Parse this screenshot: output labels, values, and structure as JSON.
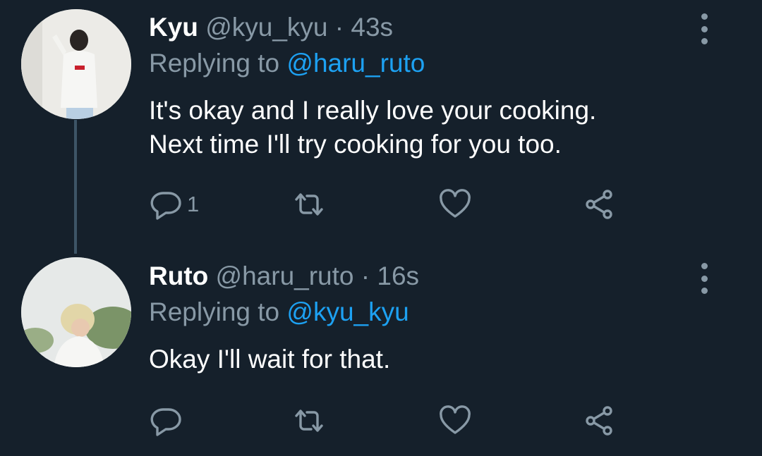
{
  "tweets": [
    {
      "name": "Kyu",
      "handle": "@kyu_kyu",
      "separator": "·",
      "time": "43s",
      "replying_prefix": "Replying to",
      "replying_to": "@haru_ruto",
      "lines": [
        "It's okay and I really love your cooking.",
        "Next time I'll try cooking for you too."
      ],
      "reply_count": "1"
    },
    {
      "name": "Ruto",
      "handle": "@haru_ruto",
      "separator": "·",
      "time": "16s",
      "replying_prefix": "Replying to",
      "replying_to": "@kyu_kyu",
      "lines": [
        "Okay I'll wait for that."
      ],
      "reply_count": ""
    }
  ],
  "icons": [
    "reply-icon",
    "retweet-icon",
    "like-icon",
    "share-icon",
    "more-options-icon"
  ],
  "colors": {
    "background": "#15202b",
    "text": "#ffffff",
    "muted": "#8899a6",
    "accent": "#1da1f2"
  }
}
